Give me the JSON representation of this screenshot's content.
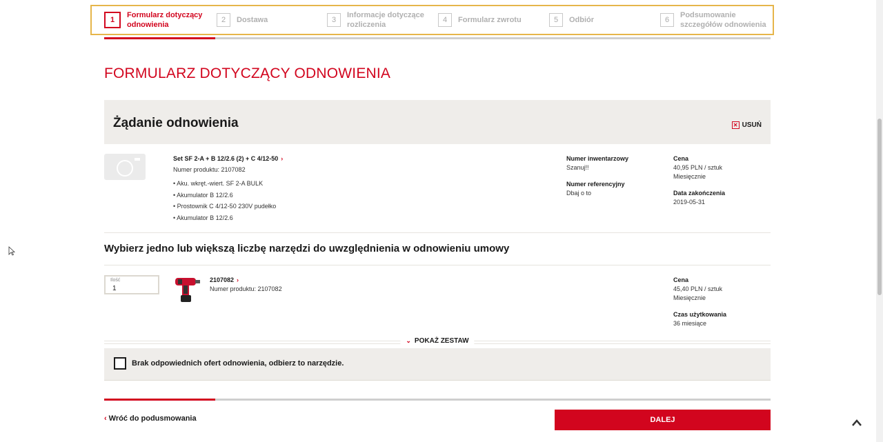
{
  "stepper": {
    "steps": [
      {
        "num": "1",
        "label": "Formularz dotyczący odnowienia",
        "line1": "Formularz dotyczący",
        "line2": "odnowienia"
      },
      {
        "num": "2",
        "label": "Dostawa",
        "line1": "Dostawa",
        "line2": ""
      },
      {
        "num": "3",
        "label": "Informacje dotyczące rozliczenia",
        "line1": "Informacje dotyczące",
        "line2": "rozliczenia"
      },
      {
        "num": "4",
        "label": "Formularz zwrotu",
        "line1": "Formularz zwrotu",
        "line2": ""
      },
      {
        "num": "5",
        "label": "Odbiór",
        "line1": "Odbiór",
        "line2": ""
      },
      {
        "num": "6",
        "label": "Podsumowanie szczegółów odnowienia",
        "line1": "Podsumowanie",
        "line2": "szczegółów odnowienia"
      }
    ],
    "active_step": 1
  },
  "page_title": "FORMULARZ DOTYCZĄCY ODNOWIENIA",
  "request": {
    "title": "Żądanie odnowienia",
    "remove_label": "USUŃ",
    "product": {
      "name": "Set SF 2-A + B 12/2.6 (2) + C 4/12-50",
      "product_number": "Numer produktu: 2107082",
      "components": [
        "Aku. wkręt.-wiert. SF 2-A BULK",
        "Akumulator B 12/2.6",
        "Prostownik C 4/12-50 230V pudełko",
        "Akumulator B 12/2.6"
      ]
    },
    "inventory_number_label": "Numer inwentarzowy",
    "inventory_number_value": "Szanuj!!",
    "reference_number_label": "Numer referencyjny",
    "reference_number_value": "Dbaj o to",
    "price_label": "Cena",
    "price_value": "40,95 PLN / sztuk",
    "price_period": "Miesięcznie",
    "end_date_label": "Data zakończenia",
    "end_date_value": "2019-05-31"
  },
  "tools_section": {
    "title": "Wybierz jedno lub większą liczbę narzędzi do uwzględnienia w odnowieniu umowy",
    "item": {
      "qty_label": "Ilość",
      "qty_value": "1",
      "code": "2107082",
      "product_number": "Numer produktu: 2107082",
      "price_label": "Cena",
      "price_value": "45,40 PLN / sztuk",
      "price_period": "Miesięcznie",
      "usage_label": "Czas użytkowania",
      "usage_value": "36 miesiące"
    },
    "show_set_label": "POKAŻ ZESTAW"
  },
  "no_offer": {
    "label": "Brak odpowiednich ofert odnowienia, odbierz to narzędzie.",
    "checked": false
  },
  "footer": {
    "back_label": "Wróć do podusmowania",
    "next_label": "DALEJ"
  },
  "colors": {
    "accent": "#d2051e",
    "panel": "#efedea",
    "highlight_border": "#e6b54a"
  }
}
